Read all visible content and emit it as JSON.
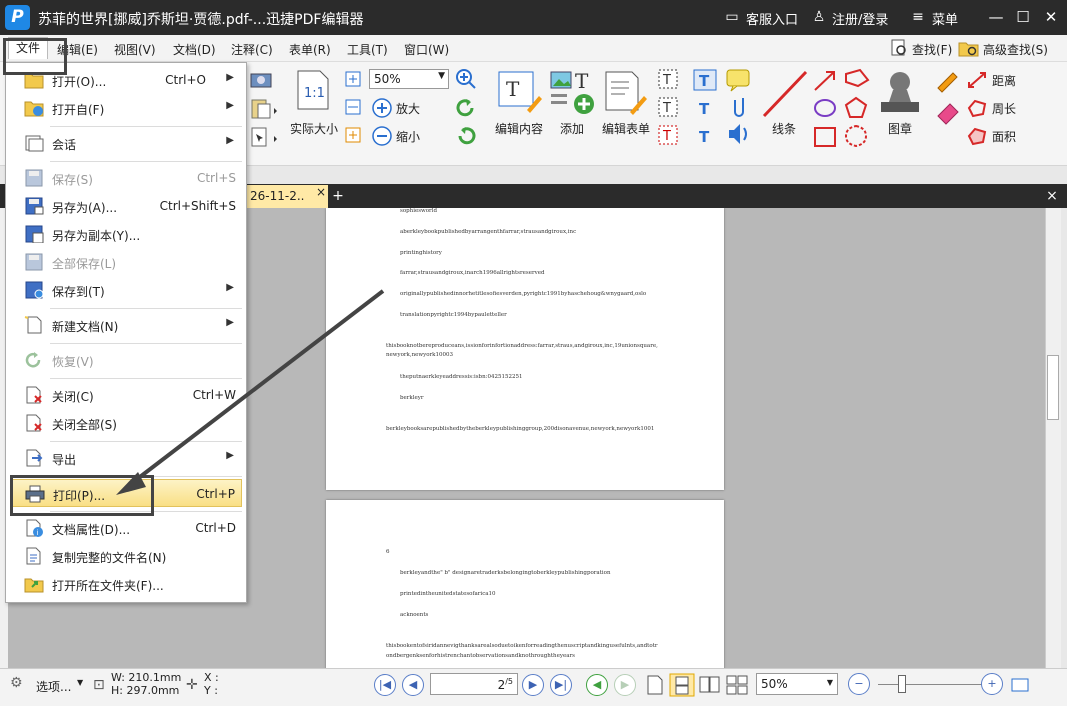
{
  "window": {
    "title": "苏菲的世界[挪威]乔斯坦·贾德.pdf-...迅捷PDF编辑器",
    "service_label": "客服入口",
    "login_label": "注册/登录",
    "menu_label": "菜单"
  },
  "menubar": {
    "items": [
      "文件",
      "编辑(E)",
      "视图(V)",
      "文档(D)",
      "注释(C)",
      "表单(R)",
      "工具(T)",
      "窗口(W)"
    ],
    "find_label": "查找(F)",
    "advanced_find_label": "高级查找(S)"
  },
  "ribbon": {
    "actual_size_label": "实际大小",
    "zoom_value": "50%",
    "zoom_in_label": "放大",
    "zoom_out_label": "缩小",
    "edit_content_label": "编辑内容",
    "add_label": "添加",
    "edit_form_label": "编辑表单",
    "lines_label": "线条",
    "stamp_label": "图章",
    "distance_label": "距离",
    "perimeter_label": "周长",
    "area_label": "面积"
  },
  "tabs": {
    "doc_tab_label": "26-11-2..",
    "close_glyph": "×",
    "add_glyph": "+"
  },
  "file_menu": {
    "items": [
      {
        "label": "打开(O)...",
        "shortcut": "Ctrl+O",
        "submenu": true
      },
      {
        "label": "打开自(F)",
        "shortcut": "",
        "submenu": true
      },
      {
        "label": "会话",
        "shortcut": "",
        "submenu": true
      },
      {
        "label": "保存(S)",
        "shortcut": "Ctrl+S",
        "disabled": true
      },
      {
        "label": "另存为(A)...",
        "shortcut": "Ctrl+Shift+S"
      },
      {
        "label": "另存为副本(Y)..."
      },
      {
        "label": "全部保存(L)",
        "disabled": true
      },
      {
        "label": "保存到(T)",
        "submenu": true
      },
      {
        "label": "新建文档(N)",
        "submenu": true
      },
      {
        "label": "恢复(V)",
        "disabled": true
      },
      {
        "label": "关闭(C)",
        "shortcut": "Ctrl+W"
      },
      {
        "label": "关闭全部(S)"
      },
      {
        "label": "导出",
        "submenu": true
      },
      {
        "label": "打印(P)...",
        "shortcut": "Ctrl+P",
        "highlighted": true
      },
      {
        "label": "文档属性(D)...",
        "shortcut": "Ctrl+D"
      },
      {
        "label": "复制完整的文件名(N)"
      },
      {
        "label": "打开所在文件夹(F)..."
      }
    ],
    "submenu_glyph": "▶"
  },
  "page1_lines": [
    "sophiesworld",
    "aberkleybookpublishedbyarrangenthfarrar,strausandgiroux,inc",
    "printinghistory",
    "farrar,strausandgiroux,inarch1996allrightsreserved",
    "originallypublishedinnorhetitlesofiesverden,pyrightc1991byhaschehoug&wnygaard,oslo",
    "translationpyrightc1994bypauletteller",
    "thisbooknotbereproduceans,issionforinfortionaddress:farrar,straus,andgiroux,inc,19unionsquare,",
    "newyork,newyork10003",
    "theputnaerkleyeaddressis:isbn:0425152251",
    "berkleyr",
    "berkleybooksarepublishedbytheberkleypublishinggroup,200disonavenue,newyork,newyork1001"
  ],
  "page2_lines": [
    "6",
    "berkleyandthe\" b\" designaretraderksbelongingtoberkleypublishingporation",
    "printedintheunitedstatesofarica10",
    "acknoents",
    "thisbookentofsiridannevigthanksarealsoduetoikenforreadingthenuscriptandkingusefulnts,andtotr",
    "ondbergenksenforhistrenchantobservationsandknothroughtheyears"
  ],
  "status": {
    "options_label": "选项...",
    "width_label": "W: 210.1mm",
    "height_label": "H: 297.0mm",
    "x_label": "X :",
    "y_label": "Y :",
    "page_value": "2",
    "page_total": "5",
    "zoom_value": "50%"
  }
}
